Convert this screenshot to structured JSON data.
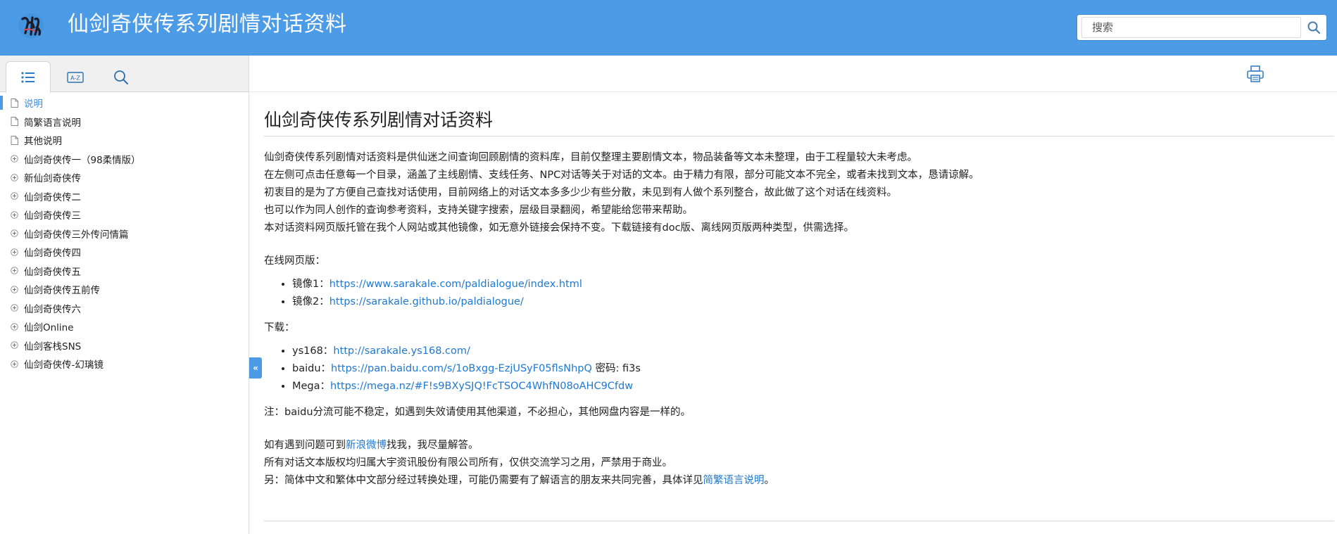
{
  "header": {
    "title": "仙剑奇侠传系列剧情对话资料",
    "search_placeholder": "搜索"
  },
  "sidebar": {
    "tabs": [
      {
        "name": "contents",
        "icon": "list-icon"
      },
      {
        "name": "index",
        "icon": "a-z-index-icon"
      },
      {
        "name": "search",
        "icon": "search-icon"
      }
    ],
    "items": [
      {
        "label": "说明",
        "icon": "page-icon",
        "selected": true
      },
      {
        "label": "简繁语言说明",
        "icon": "page-icon"
      },
      {
        "label": "其他说明",
        "icon": "page-icon"
      },
      {
        "label": "仙剑奇侠传一（98柔情版）",
        "icon": "expand-icon"
      },
      {
        "label": "新仙剑奇侠传",
        "icon": "expand-icon"
      },
      {
        "label": "仙剑奇侠传二",
        "icon": "expand-icon"
      },
      {
        "label": "仙剑奇侠传三",
        "icon": "expand-icon"
      },
      {
        "label": "仙剑奇侠传三外传问情篇",
        "icon": "expand-icon"
      },
      {
        "label": "仙剑奇侠传四",
        "icon": "expand-icon"
      },
      {
        "label": "仙剑奇侠传五",
        "icon": "expand-icon"
      },
      {
        "label": "仙剑奇侠传五前传",
        "icon": "expand-icon"
      },
      {
        "label": "仙剑奇侠传六",
        "icon": "expand-icon"
      },
      {
        "label": "仙剑Online",
        "icon": "expand-icon"
      },
      {
        "label": "仙剑客栈SNS",
        "icon": "expand-icon"
      },
      {
        "label": "仙剑奇侠传-幻璃镜",
        "icon": "expand-icon"
      }
    ],
    "collapse_label": "«"
  },
  "main": {
    "page_title": "仙剑奇侠传系列剧情对话资料",
    "intro_lines": [
      "仙剑奇侠传系列剧情对话资料是供仙迷之间查询回顾剧情的资料库，目前仅整理主要剧情文本，物品装备等文本未整理，由于工程量较大未考虑。",
      "在左侧可点击任意每一个目录，涵盖了主线剧情、支线任务、NPC对话等关于对话的文本。由于精力有限，部分可能文本不完全，或者未找到文本，恳请谅解。",
      "初衷目的是为了方便自己查找对话使用，目前网络上的对话文本多多少少有些分散，未见到有人做个系列整合，故此做了这个对话在线资料。",
      "也可以作为同人创作的查询参考资料，支持关键字搜索，层级目录翻阅，希望能给您带来帮助。",
      "本对话资料网页版托管在我个人网站或其他镜像，如无意外链接会保持不变。下载链接有doc版、离线网页版两种类型，供需选择。"
    ],
    "online_label": "在线网页版：",
    "online_links": [
      {
        "prefix": "镜像1：",
        "url": "https://www.sarakale.com/paldialogue/index.html",
        "suffix": ""
      },
      {
        "prefix": "镜像2：",
        "url": "https://sarakale.github.io/paldialogue/",
        "suffix": ""
      }
    ],
    "download_label": "下载：",
    "download_links": [
      {
        "prefix": "ys168：",
        "url": "http://sarakale.ys168.com/",
        "suffix": ""
      },
      {
        "prefix": "baidu：",
        "url": "https://pan.baidu.com/s/1oBxgg-EzjUSyF05flsNhpQ",
        "suffix": " 密码: fi3s"
      },
      {
        "prefix": "Mega：",
        "url": "https://mega.nz/#F!s9BXySJQ!FcTSOC4WhfN08oAHC9Cfdw",
        "suffix": ""
      }
    ],
    "note": "注：baidu分流可能不稳定，如遇到失效请使用其他渠道，不必担心，其他网盘内容是一样的。",
    "contact": {
      "before": "如有遇到问题可到",
      "link": "新浪微博",
      "after": "找我，我尽量解答。"
    },
    "copyright": "所有对话文本版权均归属大宇资讯股份有限公司所有，仅供交流学习之用，严禁用于商业。",
    "other": {
      "before": "另：简体中文和繁体中文部分经过转换处理，可能仍需要有了解语言的朋友来共同完善，具体详见",
      "link": "简繁语言说明",
      "after": "。"
    }
  },
  "colors": {
    "header_bg": "#4c9be6",
    "link": "#1f78d1",
    "selected": "#3d8ee0"
  }
}
